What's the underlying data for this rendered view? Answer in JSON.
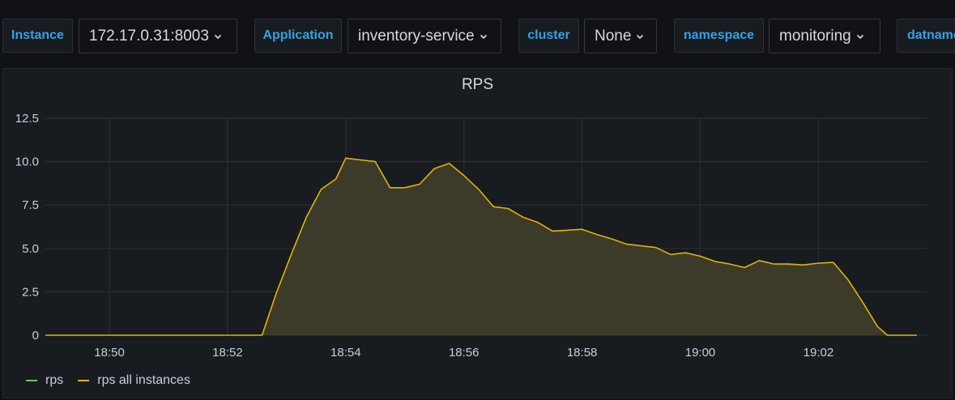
{
  "variables": [
    {
      "label": "Instance",
      "value": "172.17.0.31:8003"
    },
    {
      "label": "Application",
      "value": "inventory-service"
    },
    {
      "label": "cluster",
      "value": "None"
    },
    {
      "label": "namespace",
      "value": "monitoring"
    },
    {
      "label": "datname",
      "value": ""
    }
  ],
  "colors": {
    "accent": "#33a2e5",
    "series_rps": "#73bf69",
    "series_all": "#e0b400",
    "fill_all": "#3c3a28",
    "grid": "#2f3238"
  },
  "chart_data": {
    "type": "area",
    "title": "RPS",
    "xlabel": "",
    "ylabel": "",
    "x_ticks": [
      "18:50",
      "18:52",
      "18:54",
      "18:56",
      "18:58",
      "19:00",
      "19:02"
    ],
    "y_ticks": [
      "0",
      "2.5",
      "5.0",
      "7.5",
      "10.0",
      "12.5"
    ],
    "ylim": [
      0,
      12.5
    ],
    "xlim": [
      "18:48:55",
      "19:03:40"
    ],
    "grid": true,
    "legend_position": "bottom-left",
    "series": [
      {
        "name": "rps",
        "values": []
      },
      {
        "name": "rps all instances",
        "x": [
          "18:48:55",
          "18:52:35",
          "18:52:50",
          "18:53:05",
          "18:53:20",
          "18:53:35",
          "18:53:50",
          "18:54:00",
          "18:54:15",
          "18:54:30",
          "18:54:45",
          "18:55:00",
          "18:55:15",
          "18:55:30",
          "18:55:45",
          "18:56:00",
          "18:56:15",
          "18:56:30",
          "18:56:45",
          "18:57:00",
          "18:57:15",
          "18:57:30",
          "18:57:45",
          "18:58:00",
          "18:58:15",
          "18:58:30",
          "18:58:45",
          "18:59:00",
          "18:59:15",
          "18:59:30",
          "18:59:45",
          "19:00:00",
          "19:00:15",
          "19:00:30",
          "19:00:45",
          "19:01:00",
          "19:01:15",
          "19:01:30",
          "19:01:45",
          "19:02:00",
          "19:02:15",
          "19:02:30",
          "19:02:45",
          "19:03:00",
          "19:03:10",
          "19:03:40"
        ],
        "values": [
          0,
          0,
          2.5,
          4.7,
          6.8,
          8.4,
          9.0,
          10.2,
          10.1,
          10.0,
          8.5,
          8.5,
          8.7,
          9.6,
          9.9,
          9.2,
          8.4,
          7.4,
          7.3,
          6.8,
          6.5,
          6.0,
          6.05,
          6.1,
          5.8,
          5.55,
          5.25,
          5.15,
          5.05,
          4.65,
          4.75,
          4.55,
          4.25,
          4.1,
          3.9,
          4.3,
          4.1,
          4.1,
          4.05,
          4.15,
          4.2,
          3.2,
          1.9,
          0.5,
          0,
          0
        ]
      }
    ]
  }
}
